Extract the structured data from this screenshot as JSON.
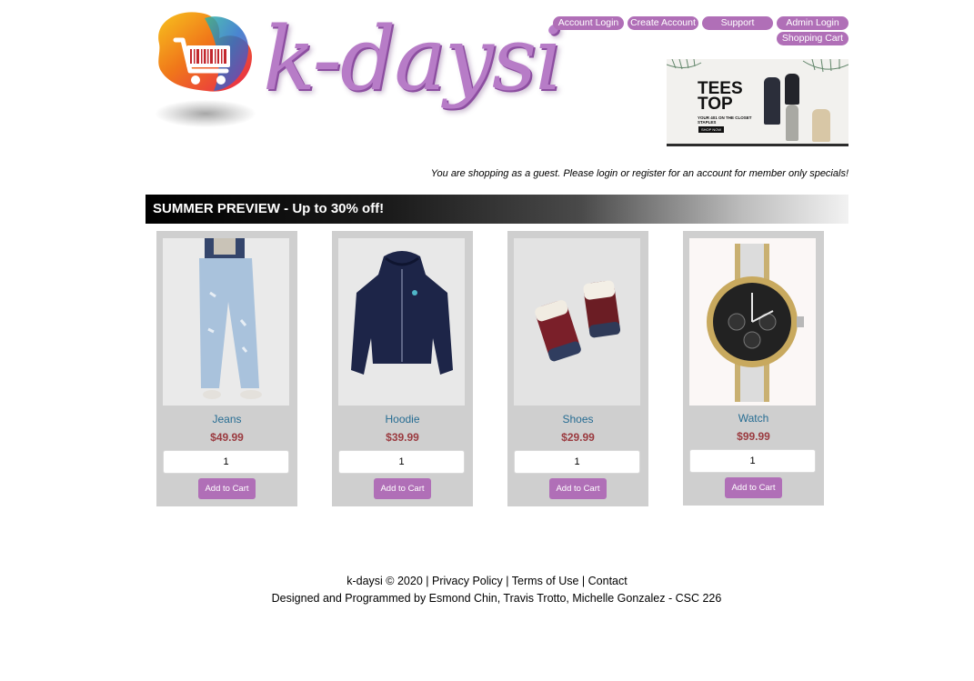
{
  "brand": {
    "name": "k-daysi"
  },
  "nav": {
    "account_login": "Account Login",
    "create_account": "Create Account",
    "support": "Support",
    "admin_login": "Admin Login",
    "shopping_cart": "Shopping Cart"
  },
  "banner": {
    "title_line1": "TEES",
    "title_line2": "TOP",
    "subtitle": "YOUR 401 ON THE CLOSET STAPLES",
    "cta": "SHOP NOW"
  },
  "guest_message": "You are shopping as a guest. Please login or register for an account for member only specials!",
  "section_title": "SUMMER PREVIEW - Up to 30% off!",
  "products": [
    {
      "name": "Jeans",
      "price": "$49.99",
      "qty": "1",
      "button": "Add to Cart"
    },
    {
      "name": "Hoodie",
      "price": "$39.99",
      "qty": "1",
      "button": "Add to Cart"
    },
    {
      "name": "Shoes",
      "price": "$29.99",
      "qty": "1",
      "button": "Add to Cart"
    },
    {
      "name": "Watch",
      "price": "$99.99",
      "qty": "1",
      "button": "Add to Cart"
    }
  ],
  "footer": {
    "copyright": "k-daysi © 2020",
    "separator": "|",
    "privacy": "Privacy Policy",
    "terms": "Terms of Use",
    "contact": "Contact",
    "credits": "Designed and Programmed by Esmond Chin, Travis Trotto, Michelle Gonzalez - CSC 226"
  },
  "colors": {
    "accent_purple": "#b06fb7",
    "product_name": "#276d93",
    "price": "#9b3b40",
    "card_background": "#cfcfcf"
  }
}
